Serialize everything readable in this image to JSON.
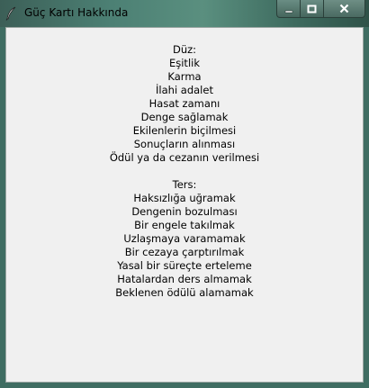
{
  "window": {
    "title": "Güç Kartı Hakkında",
    "icon": "feather-icon",
    "controls": [
      "minimize-icon",
      "maximize-icon",
      "close-icon"
    ]
  },
  "content": {
    "upright_heading": "Düz:",
    "upright_items": [
      "Eşitlik",
      "Karma",
      "İlahi adalet",
      "Hasat zamanı",
      "Denge sağlamak",
      "Ekilenlerin biçilmesi",
      "Sonuçların alınması",
      "Ödül ya da cezanın verilmesi"
    ],
    "reversed_heading": "Ters:",
    "reversed_items": [
      "Haksızlığa uğramak",
      "Dengenin bozulması",
      "Bir engele takılmak",
      "Uzlaşmaya varamamak",
      "Bir cezaya çarptırılmak",
      "Yasal bir süreçte erteleme",
      "Hatalardan ders almamak",
      "Beklenen ödülü alamamak"
    ]
  }
}
